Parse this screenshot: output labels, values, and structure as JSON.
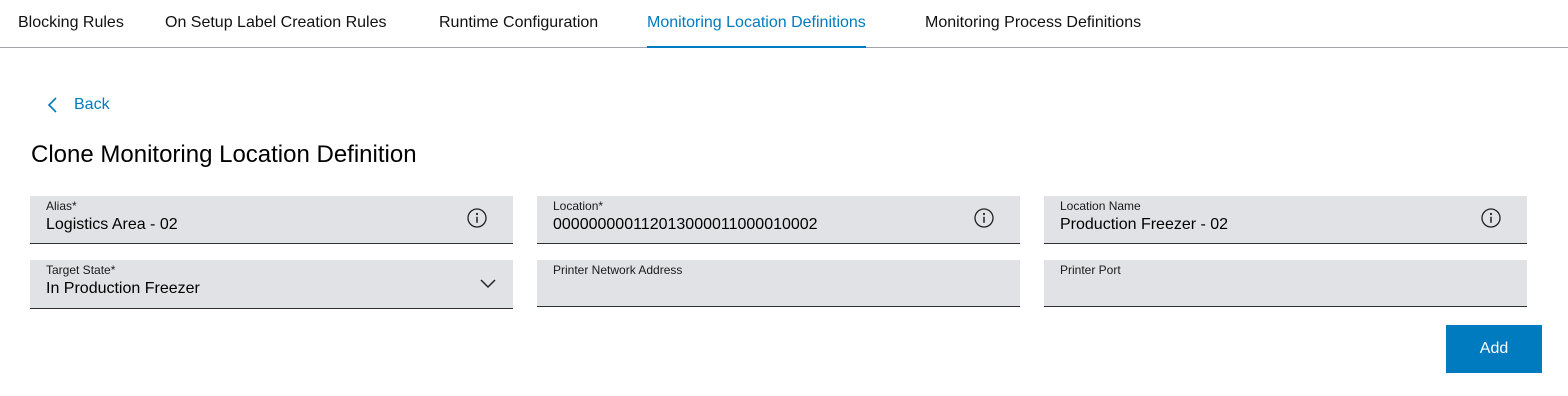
{
  "tabs": [
    {
      "label": "Blocking Rules",
      "active": false
    },
    {
      "label": "On Setup Label Creation Rules",
      "active": false
    },
    {
      "label": "Runtime Configuration",
      "active": false
    },
    {
      "label": "Monitoring Location Definitions",
      "active": true
    },
    {
      "label": "Monitoring Process Definitions",
      "active": false
    }
  ],
  "back_label": "Back",
  "page_title": "Clone Monitoring Location Definition",
  "fields": {
    "alias": {
      "label": "Alias*",
      "value": "Logistics Area - 02",
      "icon": "info-icon"
    },
    "location": {
      "label": "Location*",
      "value": "000000000112013000011000010002",
      "icon": "info-icon"
    },
    "location_name": {
      "label": "Location Name",
      "value": "Production Freezer - 02",
      "icon": "info-icon"
    },
    "target_state": {
      "label": "Target State*",
      "value": "In Production Freezer",
      "icon": "chevron-down-icon"
    },
    "printer_network_address": {
      "label": "Printer Network Address",
      "value": ""
    },
    "printer_port": {
      "label": "Printer Port",
      "value": ""
    }
  },
  "add_button_label": "Add",
  "colors": {
    "accent": "#007bc0",
    "field_bg": "#e0e2e5",
    "tab_border": "#a0a4a8"
  }
}
